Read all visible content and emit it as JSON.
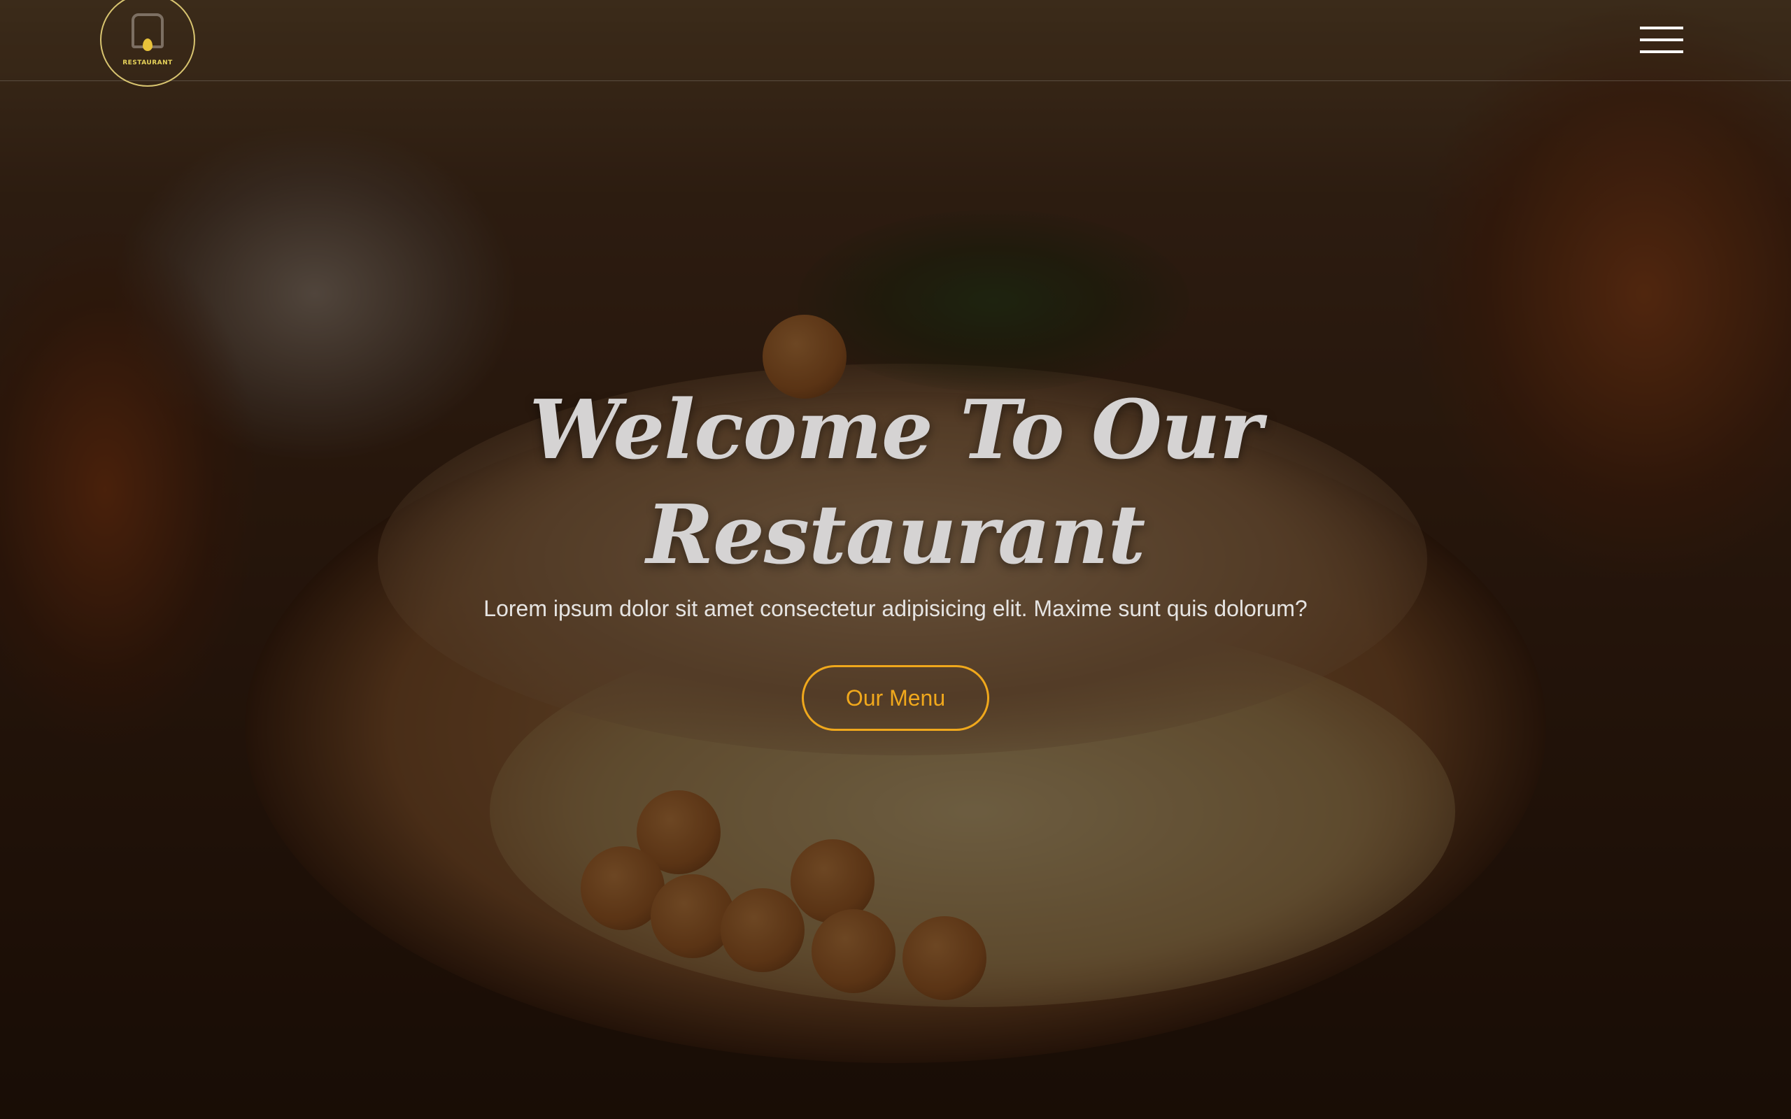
{
  "navbar": {
    "logo_text": "RESTAURANT",
    "menu_icon": "hamburger-menu-icon"
  },
  "hero": {
    "title_line1": "Welcome To Our",
    "title_line2": "Restaurant",
    "subtitle": "Lorem ipsum dolor sit amet consectetur adipisicing elit. Maxime sunt quis dolorum?",
    "cta_label": "Our Menu"
  },
  "colors": {
    "accent": "#f0a81c",
    "logo_gold": "#d8c470",
    "title_text": "#d5d3d3"
  }
}
